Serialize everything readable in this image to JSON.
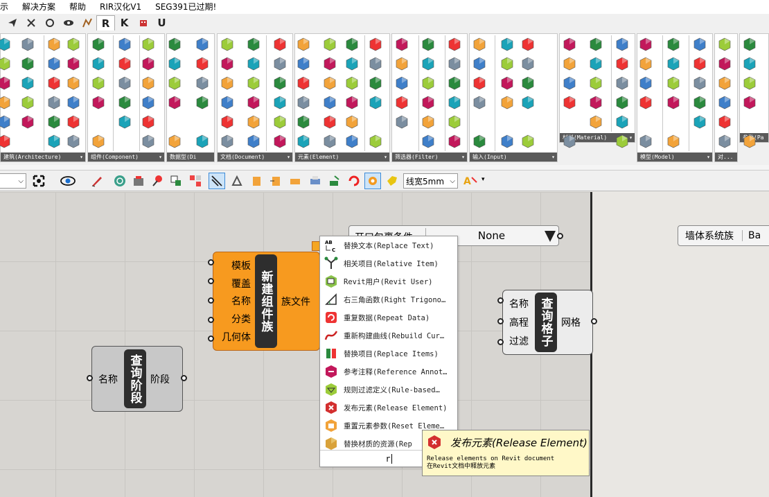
{
  "menubar": {
    "items": [
      "示",
      "解决方案",
      "帮助",
      "RIR汉化V1",
      "SEG391已过期!"
    ]
  },
  "tabbar": {
    "tabs": [
      "R",
      "K",
      "U"
    ]
  },
  "ribbon": {
    "panels": [
      {
        "caption": "建筑(Architecture)"
      },
      {
        "caption": "组件(Component)"
      },
      {
        "caption": "数据型(Di"
      },
      {
        "caption": "文档(Document)"
      },
      {
        "caption": "元素(Element)"
      },
      {
        "caption": "筛选器(Filter)"
      },
      {
        "caption": "输入(Input)"
      },
      {
        "caption": "材料(Material)"
      },
      {
        "caption": "模型(Model)"
      },
      {
        "caption": "对..."
      },
      {
        "caption": "参数(Pa"
      }
    ]
  },
  "toolbar2": {
    "linewidth": "线宽5mm"
  },
  "nodes": {
    "query_phase": {
      "inputs": [
        "名称"
      ],
      "title": "查询阶段",
      "outputs": [
        "阶段"
      ]
    },
    "new_family": {
      "inputs": [
        "模板",
        "覆盖",
        "名称",
        "分类",
        "几何体"
      ],
      "title": "新建组件族",
      "outputs": [
        "族文件"
      ]
    },
    "query_grid": {
      "inputs": [
        "名称",
        "高程",
        "过滤"
      ],
      "title": "查询格子",
      "outputs": [
        "网格"
      ]
    }
  },
  "valuelist": {
    "label": "开口包裹条件",
    "value": "None"
  },
  "wall_box": {
    "label": "墙体系统族",
    "value": "Ba"
  },
  "dropdown": {
    "items": [
      {
        "label": "替换文本(Replace Text)",
        "icon": "replace-text-icon"
      },
      {
        "label": "相关项目(Relative Item)",
        "icon": "relative-item-icon"
      },
      {
        "label": "Revit用户(Revit User)",
        "icon": "revit-user-icon"
      },
      {
        "label": "右三角函数(Right Trigono…",
        "icon": "right-triangle-icon"
      },
      {
        "label": "重复数据(Repeat Data)",
        "icon": "repeat-data-icon"
      },
      {
        "label": "重新构建曲线(Rebuild Cur…",
        "icon": "rebuild-curve-icon"
      },
      {
        "label": "替换项目(Replace Items)",
        "icon": "replace-items-icon"
      },
      {
        "label": "参考注释(Reference Annot…",
        "icon": "reference-annotation-icon"
      },
      {
        "label": "规则过滤定义(Rule-based…",
        "icon": "rule-filter-icon"
      },
      {
        "label": "发布元素(Release Element)",
        "icon": "release-element-icon"
      },
      {
        "label": "重置元素参数(Reset Eleme…",
        "icon": "reset-element-icon"
      },
      {
        "label": "替换材质的资源(Rep",
        "icon": "replace-material-icon"
      }
    ],
    "search": "r"
  },
  "tooltip": {
    "title": "发布元素(Release Element)",
    "desc_en": "Release elements on Revit document",
    "desc_cn": "在Revit文档中释放元素"
  }
}
